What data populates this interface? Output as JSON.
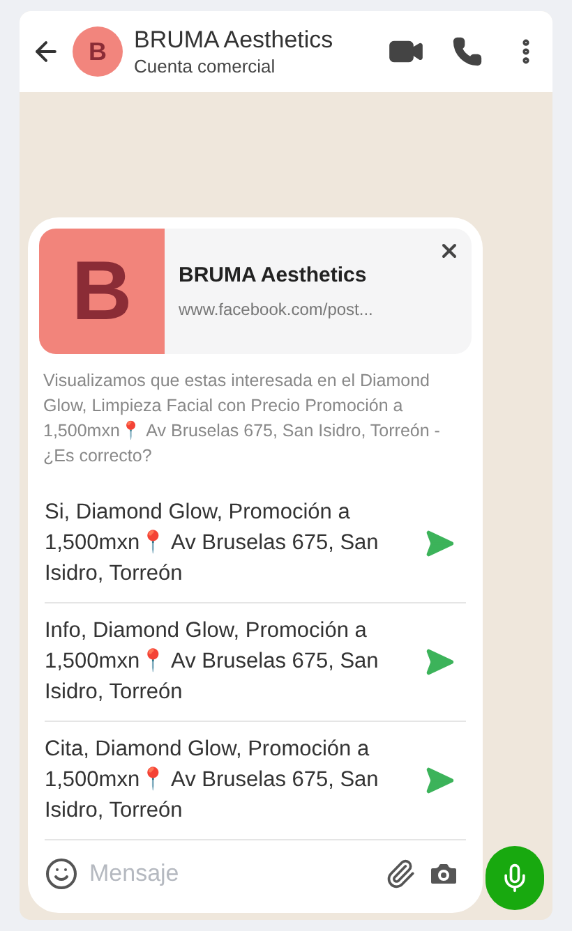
{
  "header": {
    "avatar_letter": "B",
    "title": "BRUMA Aesthetics",
    "subtitle": "Cuenta comercial"
  },
  "link_preview": {
    "letter": "B",
    "title": "BRUMA Aesthetics",
    "url": "www.facebook.com/post..."
  },
  "intro": "Visualizamos que estas interesada en el Diamond Glow, Limpieza Facial con Precio Promoción a 1,500mxn📍 Av Bruselas 675, San Isidro, Torreón - ¿Es correcto?",
  "suggestions": [
    {
      "text": "Si, Diamond Glow, Promoción a 1,500mxn📍 Av Bruselas 675, San Isidro, Torreón"
    },
    {
      "text": "Info, Diamond Glow, Promoción a 1,500mxn📍 Av Bruselas 675, San Isidro, Torreón"
    },
    {
      "text": "Cita, Diamond Glow, Promoción a 1,500mxn📍 Av Bruselas 675, San Isidro, Torreón"
    }
  ],
  "message_field": {
    "placeholder": "Mensaje"
  }
}
